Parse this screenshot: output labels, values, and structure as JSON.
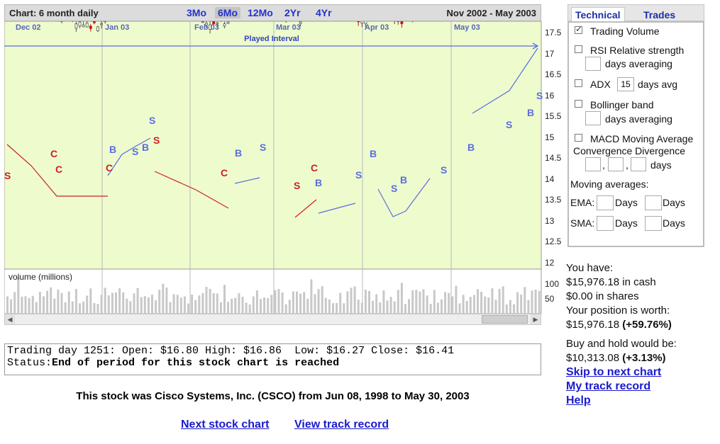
{
  "header": {
    "chart_title": "Chart: 6 month daily",
    "ranges": [
      "3Mo",
      "6Mo",
      "12Mo",
      "2Yr",
      "4Yr"
    ],
    "active_range": "6Mo",
    "date_range": "Nov 2002 - May 2003"
  },
  "chart": {
    "month_labels": [
      "Dec 02",
      "Jan 03",
      "Feb 03",
      "Mar 03",
      "Apr 03",
      "May 03"
    ],
    "played_interval_label": "Played Interval",
    "price_ticks": [
      "17.5",
      "17",
      "16.5",
      "16",
      "15.5",
      "15",
      "14.5",
      "14",
      "13.5",
      "13",
      "12.5",
      "12"
    ],
    "volume_label": "volume (millions)",
    "volume_ticks": [
      "100",
      "50"
    ],
    "colors": {
      "up": "#555555",
      "down": "#cc1111",
      "buy": "#5a6ee0",
      "sell": "#cc2222",
      "bg": "#eefbcd",
      "volume": "#c8c8c8"
    }
  },
  "chart_data": {
    "type": "candlestick",
    "ylim": [
      12,
      17.7
    ],
    "signals": [
      {
        "label": "S",
        "color": "sell"
      },
      {
        "label": "C",
        "color": "sell"
      },
      {
        "label": "C",
        "color": "sell"
      },
      {
        "label": "C",
        "color": "sell"
      },
      {
        "label": "B",
        "color": "buy"
      },
      {
        "label": "S",
        "color": "buy"
      },
      {
        "label": "S",
        "color": "buy"
      },
      {
        "label": "B",
        "color": "buy"
      },
      {
        "label": "S",
        "color": "sell"
      },
      {
        "label": "C",
        "color": "sell"
      },
      {
        "label": "B",
        "color": "buy"
      },
      {
        "label": "S",
        "color": "buy"
      },
      {
        "label": "S",
        "color": "sell"
      },
      {
        "label": "C",
        "color": "sell"
      },
      {
        "label": "B",
        "color": "buy"
      },
      {
        "label": "S",
        "color": "buy"
      },
      {
        "label": "B",
        "color": "buy"
      },
      {
        "label": "S",
        "color": "buy"
      },
      {
        "label": "B",
        "color": "buy"
      },
      {
        "label": "S",
        "color": "buy"
      },
      {
        "label": "B",
        "color": "buy"
      },
      {
        "label": "S",
        "color": "buy"
      },
      {
        "label": "B",
        "color": "buy"
      },
      {
        "label": "S",
        "color": "buy"
      }
    ]
  },
  "status": {
    "trading_line": "Trading day 1251: Open: $16.80 High: $16.86  Low: $16.27 Close: $16.41",
    "status_label": "Status:",
    "status_text": "End of period for this stock chart is reached"
  },
  "footer": {
    "stock_info": "This stock was Cisco Systems, Inc. (CSCO) from Jun 08, 1998 to May 30, 2003",
    "next_chart": "Next stock chart",
    "view_track_record": "View track record"
  },
  "tabs": {
    "technical": "Technical",
    "trades": "Trades"
  },
  "technical": {
    "trading_volume": "Trading Volume",
    "rsi": "RSI Relative strength",
    "days_averaging": "days averaging",
    "adx": "ADX",
    "adx_value": "15",
    "days_avg": "days avg",
    "bollinger": "Bollinger band",
    "macd_line1": "MACD Moving Average",
    "macd_line2": "Convergence Divergence",
    "days": "days",
    "comma": ",",
    "moving_averages": "Moving averages:",
    "ema": "EMA:",
    "sma": "SMA:",
    "days_cap": "Days"
  },
  "account": {
    "you_have": "You have:",
    "cash": "$15,976.18 in cash",
    "shares": "$0.00 in shares",
    "position_label": "Your position is worth:",
    "position_value": "$15,976.18",
    "position_change": "(+59.76%)",
    "buy_hold_label": "Buy and hold would be:",
    "buy_hold_value": "$10,313.08",
    "buy_hold_change": "(+3.13%)",
    "skip_link": "Skip to next chart",
    "track_link": "My track record",
    "help_link": "Help"
  }
}
